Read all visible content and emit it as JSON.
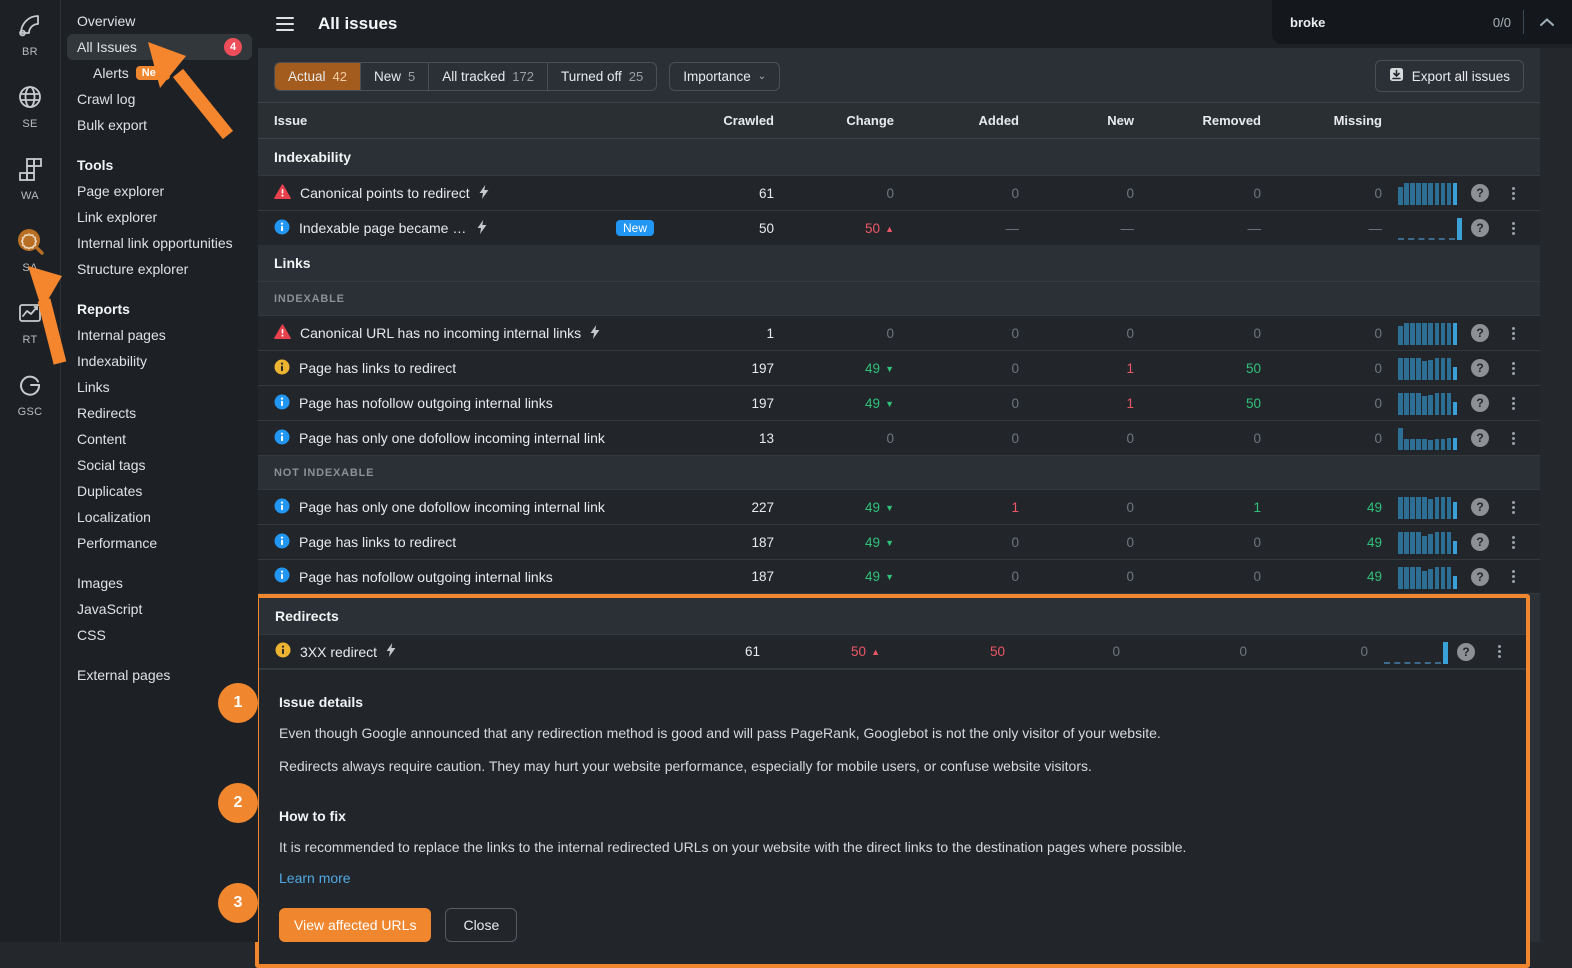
{
  "app": {
    "title": "All issues"
  },
  "find_bar": {
    "query": "broke",
    "count": "0/0"
  },
  "rail": {
    "items": [
      {
        "label": "BR",
        "icon": "brand-radar-icon",
        "active": false
      },
      {
        "label": "SE",
        "icon": "site-explorer-globe-icon",
        "active": false
      },
      {
        "label": "WA",
        "icon": "web-analytics-grid-icon",
        "active": false
      },
      {
        "label": "SA",
        "icon": "site-audit-gear-icon",
        "active": true
      },
      {
        "label": "RT",
        "icon": "rank-tracker-chart-icon",
        "active": false
      },
      {
        "label": "GSC",
        "icon": "google-search-console-icon",
        "active": false
      }
    ]
  },
  "sidebar": {
    "groups": [
      {
        "header": null,
        "items": [
          {
            "label": "Overview"
          },
          {
            "label": "All Issues",
            "selected": true,
            "badge": "4"
          },
          {
            "label": "Alerts",
            "indent": true,
            "badge_new": "New"
          },
          {
            "label": "Crawl log"
          },
          {
            "label": "Bulk export"
          }
        ]
      },
      {
        "header": "Tools",
        "items": [
          {
            "label": "Page explorer"
          },
          {
            "label": "Link explorer"
          },
          {
            "label": "Internal link opportunities"
          },
          {
            "label": "Structure explorer"
          }
        ]
      },
      {
        "header": "Reports",
        "items": [
          {
            "label": "Internal pages"
          },
          {
            "label": "Indexability"
          },
          {
            "label": "Links"
          },
          {
            "label": "Redirects"
          },
          {
            "label": "Content"
          },
          {
            "label": "Social tags"
          },
          {
            "label": "Duplicates"
          },
          {
            "label": "Localization"
          },
          {
            "label": "Performance"
          }
        ]
      },
      {
        "header": null,
        "items": [
          {
            "label": "Images"
          },
          {
            "label": "JavaScript"
          },
          {
            "label": "CSS"
          }
        ]
      },
      {
        "header": null,
        "items": [
          {
            "label": "External pages"
          }
        ]
      }
    ]
  },
  "toolbar": {
    "tabs": [
      {
        "label": "Actual",
        "count": "42",
        "active": true
      },
      {
        "label": "New",
        "count": "5",
        "active": false
      },
      {
        "label": "All tracked",
        "count": "172",
        "active": false
      },
      {
        "label": "Turned off",
        "count": "25",
        "active": false
      }
    ],
    "importance_label": "Importance",
    "export_label": "Export all issues"
  },
  "table": {
    "columns": [
      "Issue",
      "Crawled",
      "Change",
      "Added",
      "New",
      "Removed",
      "Missing"
    ],
    "sections": [
      {
        "header": "Indexability",
        "subsections": [
          {
            "label": null,
            "rows": [
              {
                "icon": "warning-red",
                "label": "Canonical points to redirect",
                "bolt": true,
                "badge": null,
                "crawled": "61",
                "change": {
                  "v": "0",
                  "c": "muted"
                },
                "added": {
                  "v": "0",
                  "c": "muted"
                },
                "new": {
                  "v": "0",
                  "c": "muted"
                },
                "removed": {
                  "v": "0",
                  "c": "muted"
                },
                "missing": {
                  "v": "0",
                  "c": "muted"
                },
                "spark": {
                  "kind": "bars",
                  "values": [
                    0.8,
                    1,
                    1,
                    1,
                    1,
                    1,
                    1,
                    1,
                    1,
                    1
                  ]
                }
              },
              {
                "icon": "info-blue",
                "label": "Indexable page became non-indexable",
                "bolt": true,
                "badge": "New",
                "crawled": "50",
                "change": {
                  "v": "50",
                  "c": "red",
                  "dir": "up"
                },
                "added": {
                  "v": "—",
                  "c": "muted"
                },
                "new": {
                  "v": "—",
                  "c": "muted"
                },
                "removed": {
                  "v": "—",
                  "c": "muted"
                },
                "missing": {
                  "v": "—",
                  "c": "muted"
                },
                "spark": {
                  "kind": "new"
                }
              }
            ]
          }
        ]
      },
      {
        "header": "Links",
        "subsections": [
          {
            "label": "INDEXABLE",
            "rows": [
              {
                "icon": "warning-red",
                "label": "Canonical URL has no incoming internal links",
                "bolt": true,
                "badge": null,
                "crawled": "1",
                "change": {
                  "v": "0",
                  "c": "muted"
                },
                "added": {
                  "v": "0",
                  "c": "muted"
                },
                "new": {
                  "v": "0",
                  "c": "muted"
                },
                "removed": {
                  "v": "0",
                  "c": "muted"
                },
                "missing": {
                  "v": "0",
                  "c": "muted"
                },
                "spark": {
                  "kind": "bars",
                  "values": [
                    0.85,
                    1,
                    1,
                    1,
                    1,
                    1,
                    1,
                    1,
                    1,
                    1
                  ]
                }
              },
              {
                "icon": "info-yellow",
                "label": "Page has links to redirect",
                "bolt": false,
                "badge": null,
                "crawled": "197",
                "change": {
                  "v": "49",
                  "c": "green",
                  "dir": "down"
                },
                "added": {
                  "v": "0",
                  "c": "muted"
                },
                "new": {
                  "v": "1",
                  "c": "red"
                },
                "removed": {
                  "v": "50",
                  "c": "green"
                },
                "missing": {
                  "v": "0",
                  "c": "muted"
                },
                "spark": {
                  "kind": "bars",
                  "values": [
                    1,
                    1,
                    1,
                    1,
                    0.85,
                    0.9,
                    1,
                    1,
                    1,
                    0.6
                  ]
                }
              },
              {
                "icon": "info-blue",
                "label": "Page has nofollow outgoing internal links",
                "bolt": false,
                "badge": null,
                "crawled": "197",
                "change": {
                  "v": "49",
                  "c": "green",
                  "dir": "down"
                },
                "added": {
                  "v": "0",
                  "c": "muted"
                },
                "new": {
                  "v": "1",
                  "c": "red"
                },
                "removed": {
                  "v": "50",
                  "c": "green"
                },
                "missing": {
                  "v": "0",
                  "c": "muted"
                },
                "spark": {
                  "kind": "bars",
                  "values": [
                    1,
                    1,
                    1,
                    1,
                    0.85,
                    0.9,
                    1,
                    1,
                    1,
                    0.6
                  ]
                }
              },
              {
                "icon": "info-blue",
                "label": "Page has only one dofollow incoming internal link",
                "bolt": false,
                "badge": null,
                "crawled": "13",
                "change": {
                  "v": "0",
                  "c": "muted"
                },
                "added": {
                  "v": "0",
                  "c": "muted"
                },
                "new": {
                  "v": "0",
                  "c": "muted"
                },
                "removed": {
                  "v": "0",
                  "c": "muted"
                },
                "missing": {
                  "v": "0",
                  "c": "muted"
                },
                "spark": {
                  "kind": "bars",
                  "values": [
                    1,
                    0.5,
                    0.52,
                    0.5,
                    0.5,
                    0.45,
                    0.5,
                    0.52,
                    0.55,
                    0.55
                  ]
                }
              }
            ]
          },
          {
            "label": "NOT INDEXABLE",
            "rows": [
              {
                "icon": "info-blue",
                "label": "Page has only one dofollow incoming internal link",
                "bolt": false,
                "badge": null,
                "crawled": "227",
                "change": {
                  "v": "49",
                  "c": "green",
                  "dir": "down"
                },
                "added": {
                  "v": "1",
                  "c": "red"
                },
                "new": {
                  "v": "0",
                  "c": "muted"
                },
                "removed": {
                  "v": "1",
                  "c": "green"
                },
                "missing": {
                  "v": "49",
                  "c": "green"
                },
                "spark": {
                  "kind": "bars",
                  "values": [
                    1,
                    1,
                    1,
                    1,
                    1,
                    0.9,
                    1,
                    1,
                    1,
                    0.75
                  ]
                }
              },
              {
                "icon": "info-blue",
                "label": "Page has links to redirect",
                "bolt": false,
                "badge": null,
                "crawled": "187",
                "change": {
                  "v": "49",
                  "c": "green",
                  "dir": "down"
                },
                "added": {
                  "v": "0",
                  "c": "muted"
                },
                "new": {
                  "v": "0",
                  "c": "muted"
                },
                "removed": {
                  "v": "0",
                  "c": "muted"
                },
                "missing": {
                  "v": "49",
                  "c": "green"
                },
                "spark": {
                  "kind": "bars",
                  "values": [
                    1,
                    1,
                    1,
                    1,
                    0.8,
                    0.9,
                    1,
                    1,
                    1,
                    0.6
                  ]
                }
              },
              {
                "icon": "info-blue",
                "label": "Page has nofollow outgoing internal links",
                "bolt": false,
                "badge": null,
                "crawled": "187",
                "change": {
                  "v": "49",
                  "c": "green",
                  "dir": "down"
                },
                "added": {
                  "v": "0",
                  "c": "muted"
                },
                "new": {
                  "v": "0",
                  "c": "muted"
                },
                "removed": {
                  "v": "0",
                  "c": "muted"
                },
                "missing": {
                  "v": "49",
                  "c": "green"
                },
                "spark": {
                  "kind": "bars",
                  "values": [
                    1,
                    1,
                    1,
                    1,
                    0.8,
                    0.9,
                    1,
                    1,
                    1,
                    0.6
                  ]
                }
              }
            ]
          }
        ]
      }
    ],
    "highlight": {
      "section": "Redirects",
      "rows": [
        {
          "icon": "info-yellow",
          "label": "3XX redirect",
          "bolt": true,
          "badge": null,
          "crawled": "61",
          "change": {
            "v": "50",
            "c": "red",
            "dir": "up"
          },
          "added": {
            "v": "50",
            "c": "red"
          },
          "new": {
            "v": "0",
            "c": "muted"
          },
          "removed": {
            "v": "0",
            "c": "muted"
          },
          "missing": {
            "v": "0",
            "c": "muted"
          },
          "spark": {
            "kind": "new"
          }
        }
      ],
      "steps": [
        "1",
        "2",
        "3"
      ],
      "details": {
        "title": "Issue details",
        "p1": "Even though Google announced that any redirection method is good and will pass PageRank, Googlebot is not the only visitor of your website.",
        "p2": "Redirects always require caution. They may hurt your website performance, especially for mobile users, or confuse website visitors.",
        "fix_title": "How to fix",
        "fix_text": "It is recommended to replace the links to the internal redirected URLs on your website with the direct links to the destination pages where possible.",
        "learn_more": "Learn more",
        "view_button": "View affected URLs",
        "close_button": "Close"
      }
    }
  },
  "colors": {
    "accent_orange": "#f0862d",
    "tab_active_bg": "#a35c1e",
    "green": "#30c179",
    "red": "#ee5765",
    "info_blue": "#2196f3",
    "warn_yellow": "#edb431",
    "warn_red": "#e9414d",
    "spark_blue": "#2d6f94",
    "spark_bright": "#3aa0d8",
    "link_blue": "#51a9e3",
    "badge_red": "#ee4e5a"
  }
}
